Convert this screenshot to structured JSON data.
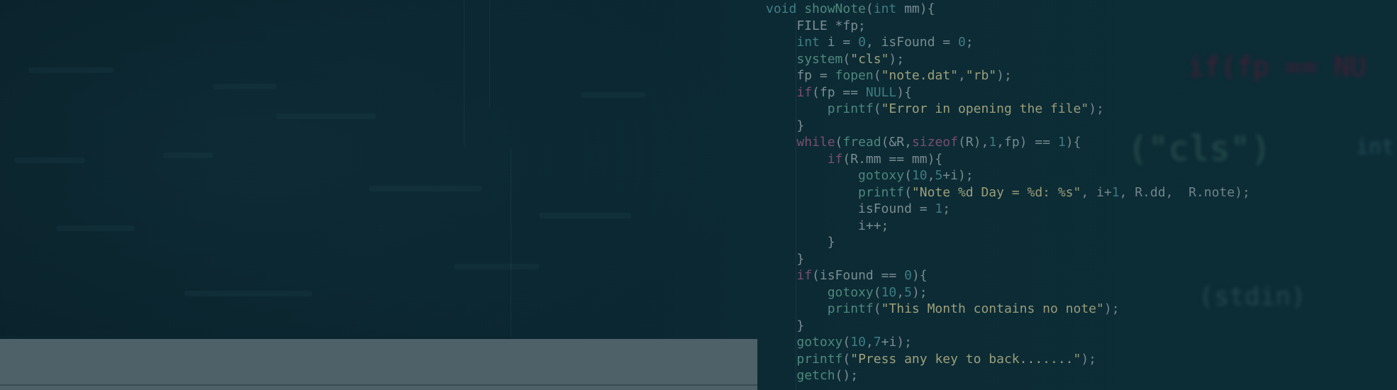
{
  "code_lines": [
    [
      {
        "t": "ty",
        "v": "void "
      },
      {
        "t": "fn",
        "v": "showNote"
      },
      {
        "t": "tx",
        "v": "("
      },
      {
        "t": "ty",
        "v": "int"
      },
      {
        "t": "tx",
        "v": " mm){"
      }
    ],
    [
      {
        "t": "tx",
        "v": "    FILE *fp;"
      }
    ],
    [
      {
        "t": "tx",
        "v": "    "
      },
      {
        "t": "ty",
        "v": "int"
      },
      {
        "t": "tx",
        "v": " i = "
      },
      {
        "t": "num",
        "v": "0"
      },
      {
        "t": "tx",
        "v": ", isFound = "
      },
      {
        "t": "num",
        "v": "0"
      },
      {
        "t": "tx",
        "v": ";"
      }
    ],
    [
      {
        "t": "tx",
        "v": "    "
      },
      {
        "t": "fn",
        "v": "system"
      },
      {
        "t": "tx",
        "v": "("
      },
      {
        "t": "str",
        "v": "\"cls\""
      },
      {
        "t": "tx",
        "v": ");"
      }
    ],
    [
      {
        "t": "tx",
        "v": "    fp = "
      },
      {
        "t": "fn",
        "v": "fopen"
      },
      {
        "t": "tx",
        "v": "("
      },
      {
        "t": "str",
        "v": "\"note.dat\""
      },
      {
        "t": "tx",
        "v": ","
      },
      {
        "t": "str",
        "v": "\"rb\""
      },
      {
        "t": "tx",
        "v": ");"
      }
    ],
    [
      {
        "t": "tx",
        "v": "    "
      },
      {
        "t": "kw",
        "v": "if"
      },
      {
        "t": "tx",
        "v": "(fp == "
      },
      {
        "t": "ty",
        "v": "NULL"
      },
      {
        "t": "tx",
        "v": "){"
      }
    ],
    [
      {
        "t": "tx",
        "v": "        "
      },
      {
        "t": "fn",
        "v": "printf"
      },
      {
        "t": "tx",
        "v": "("
      },
      {
        "t": "str",
        "v": "\"Error in opening the file\""
      },
      {
        "t": "tx",
        "v": ");"
      }
    ],
    [
      {
        "t": "tx",
        "v": "    }"
      }
    ],
    [
      {
        "t": "tx",
        "v": "    "
      },
      {
        "t": "kw",
        "v": "while"
      },
      {
        "t": "tx",
        "v": "("
      },
      {
        "t": "fn",
        "v": "fread"
      },
      {
        "t": "tx",
        "v": "(&R,"
      },
      {
        "t": "kw",
        "v": "sizeof"
      },
      {
        "t": "tx",
        "v": "(R),"
      },
      {
        "t": "num",
        "v": "1"
      },
      {
        "t": "tx",
        "v": ",fp) == "
      },
      {
        "t": "num",
        "v": "1"
      },
      {
        "t": "tx",
        "v": "){"
      }
    ],
    [
      {
        "t": "tx",
        "v": "        "
      },
      {
        "t": "kw",
        "v": "if"
      },
      {
        "t": "tx",
        "v": "(R.mm == mm){"
      }
    ],
    [
      {
        "t": "tx",
        "v": "            "
      },
      {
        "t": "fn",
        "v": "gotoxy"
      },
      {
        "t": "tx",
        "v": "("
      },
      {
        "t": "num",
        "v": "10"
      },
      {
        "t": "tx",
        "v": ","
      },
      {
        "t": "num",
        "v": "5"
      },
      {
        "t": "tx",
        "v": "+i);"
      }
    ],
    [
      {
        "t": "tx",
        "v": "            "
      },
      {
        "t": "fn",
        "v": "printf"
      },
      {
        "t": "tx",
        "v": "("
      },
      {
        "t": "str",
        "v": "\"Note %d Day = %d: %s\""
      },
      {
        "t": "tx",
        "v": ", i+"
      },
      {
        "t": "num",
        "v": "1"
      },
      {
        "t": "tx",
        "v": ", R.dd,  R.note);"
      }
    ],
    [
      {
        "t": "tx",
        "v": "            isFound = "
      },
      {
        "t": "num",
        "v": "1"
      },
      {
        "t": "tx",
        "v": ";"
      }
    ],
    [
      {
        "t": "tx",
        "v": "            i++;"
      }
    ],
    [
      {
        "t": "tx",
        "v": "        }"
      }
    ],
    [
      {
        "t": "tx",
        "v": "    }"
      }
    ],
    [
      {
        "t": "tx",
        "v": "    "
      },
      {
        "t": "kw",
        "v": "if"
      },
      {
        "t": "tx",
        "v": "(isFound == "
      },
      {
        "t": "num",
        "v": "0"
      },
      {
        "t": "tx",
        "v": "){"
      }
    ],
    [
      {
        "t": "tx",
        "v": "        "
      },
      {
        "t": "fn",
        "v": "gotoxy"
      },
      {
        "t": "tx",
        "v": "("
      },
      {
        "t": "num",
        "v": "10"
      },
      {
        "t": "tx",
        "v": ","
      },
      {
        "t": "num",
        "v": "5"
      },
      {
        "t": "tx",
        "v": ");"
      }
    ],
    [
      {
        "t": "tx",
        "v": "        "
      },
      {
        "t": "fn",
        "v": "printf"
      },
      {
        "t": "tx",
        "v": "("
      },
      {
        "t": "str",
        "v": "\"This Month contains no note\""
      },
      {
        "t": "tx",
        "v": ");"
      }
    ],
    [
      {
        "t": "tx",
        "v": "    }"
      }
    ],
    [
      {
        "t": "tx",
        "v": "    "
      },
      {
        "t": "fn",
        "v": "gotoxy"
      },
      {
        "t": "tx",
        "v": "("
      },
      {
        "t": "num",
        "v": "10"
      },
      {
        "t": "tx",
        "v": ","
      },
      {
        "t": "num",
        "v": "7"
      },
      {
        "t": "tx",
        "v": "+i);"
      }
    ],
    [
      {
        "t": "tx",
        "v": "    "
      },
      {
        "t": "fn",
        "v": "printf"
      },
      {
        "t": "tx",
        "v": "("
      },
      {
        "t": "str",
        "v": "\"Press any key to back.......\""
      },
      {
        "t": "tx",
        "v": ");"
      }
    ],
    [
      {
        "t": "tx",
        "v": "    "
      },
      {
        "t": "fn",
        "v": "getch"
      },
      {
        "t": "tx",
        "v": "();"
      }
    ]
  ],
  "background_words": [
    {
      "text": "if(fp == NU",
      "color": "#4a1f38"
    },
    {
      "text": "(\"cls\")",
      "color": "#2a5550"
    },
    {
      "text": "int",
      "color": "#2b5560"
    },
    {
      "text": "(stdin)",
      "color": "#2b4e56"
    }
  ],
  "colors": {
    "background": "#0b2630",
    "footer_bar": "#4e6168",
    "keyword": "#7d4f70",
    "type": "#3f7f86",
    "function": "#4f8a7d",
    "string": "#a3a57e",
    "text": "#7d8f95"
  }
}
